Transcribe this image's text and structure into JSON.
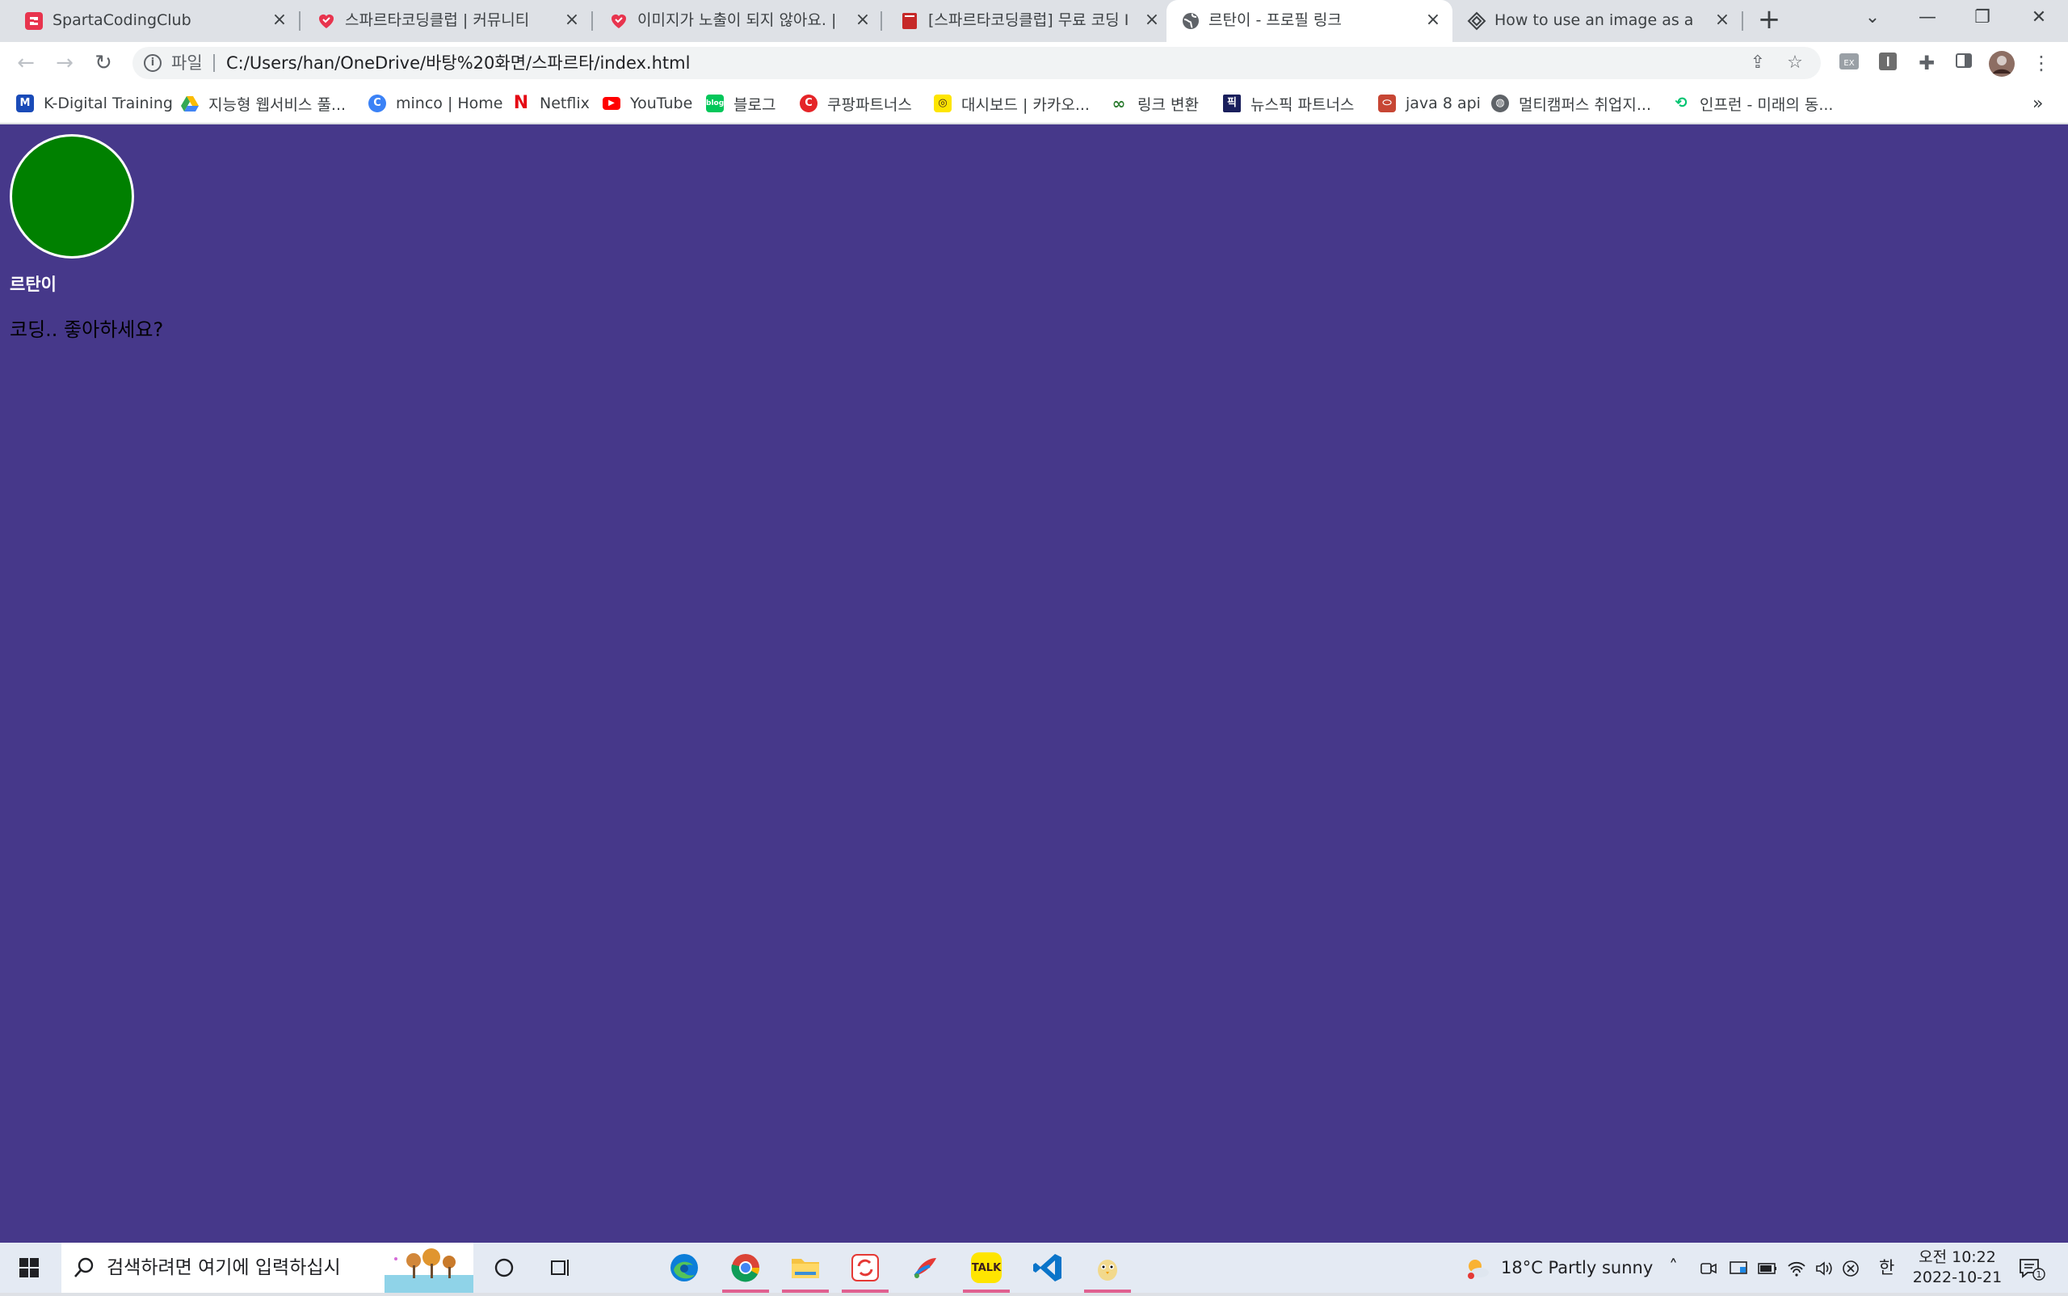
{
  "browser": {
    "tabs": [
      {
        "title": "SpartaCodingClub",
        "favicon": "sparta-logo-icon"
      },
      {
        "title": "스파르타코딩클럽 | 커뮤니티",
        "favicon": "heart-icon"
      },
      {
        "title": "이미지가 노출이 되지 않아요. |",
        "favicon": "heart-icon"
      },
      {
        "title": "[스파르타코딩클럽] 무료 코딩 I",
        "favicon": "book-icon"
      },
      {
        "title": "르탄이 - 프로필 링크",
        "favicon": "globe-icon",
        "active": true
      },
      {
        "title": "How to use an image as a link",
        "favicon": "diamond-icon"
      }
    ],
    "new_tab": "+",
    "window_controls": [
      "⌄",
      "—",
      "❐",
      "✕"
    ],
    "address": {
      "scheme_label": "파일",
      "url": "C:/Users/han/OneDrive/바탕%20화면/스파르타/index.html"
    },
    "bookmarks": [
      {
        "label": "K-Digital Training",
        "icon": "k-digital-icon",
        "color": "#1a4bb8"
      },
      {
        "label": "지능형 웹서비스 풀...",
        "icon": "google-drive-icon",
        "color": "#34a853"
      },
      {
        "label": "minco | Home",
        "icon": "minco-icon",
        "color": "#3b82f6"
      },
      {
        "label": "Netflix",
        "icon": "netflix-icon",
        "color": "#e50914"
      },
      {
        "label": "YouTube",
        "icon": "youtube-icon",
        "color": "#ff0000"
      },
      {
        "label": "블로그",
        "icon": "blog-icon",
        "color": "#03c75a"
      },
      {
        "label": "쿠팡파트너스",
        "icon": "coupang-icon",
        "color": "#e52528"
      },
      {
        "label": "대시보드 | 카카오...",
        "icon": "kakao-icon",
        "color": "#fee500"
      },
      {
        "label": "링크 변환",
        "icon": "link-icon",
        "color": "#2e7d32"
      },
      {
        "label": "뉴스픽 파트너스",
        "icon": "newspic-icon",
        "color": "#1a1f5c"
      },
      {
        "label": "java 8 api",
        "icon": "oracle-icon",
        "color": "#c74634"
      },
      {
        "label": "멀티캠퍼스 취업지...",
        "icon": "globe-icon",
        "color": "#5f6368"
      },
      {
        "label": "인프런 - 미래의 동...",
        "icon": "inflearn-icon",
        "color": "#00c471"
      }
    ],
    "bookmarks_more": "»"
  },
  "page": {
    "background": "#46388a",
    "avatar_color": "#008000",
    "profile_name": "르탄이",
    "profile_desc": "코딩.. 좋아하세요?"
  },
  "taskbar": {
    "search_placeholder": "검색하려면 여기에 입력하십시",
    "apps": [
      "edge-icon",
      "chrome-icon",
      "file-explorer-icon",
      "sync-icon",
      "paint-icon",
      "kakaotalk-icon",
      "vscode-icon",
      "bird-app-icon"
    ],
    "kakao_label": "TALK",
    "weather": "18°C  Partly sunny",
    "ime": "한",
    "clock_period": "오전 10:22",
    "clock_date": "2022-10-21",
    "notification_count": "1"
  }
}
